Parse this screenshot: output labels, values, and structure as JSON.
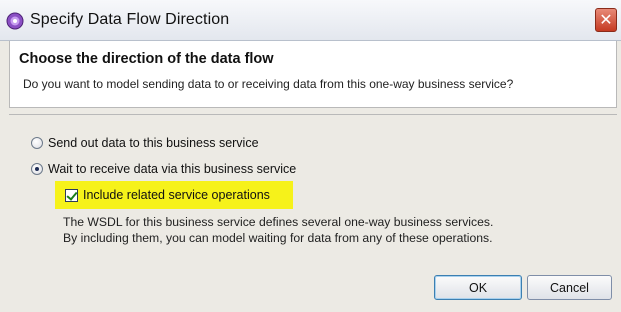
{
  "window": {
    "title": "Specify Data Flow Direction",
    "close_glyph": "✕",
    "icon": "wizard-icon"
  },
  "header": {
    "title": "Choose the direction of the data flow",
    "description": "Do you want to model sending data to or receiving data from this one-way business service?"
  },
  "options": {
    "send": {
      "label": "Send out data to this business service",
      "selected": false
    },
    "receive": {
      "label": "Wait to receive data via this business service",
      "selected": true
    },
    "include_related": {
      "label": "Include related service operations",
      "checked": true
    }
  },
  "note": {
    "line1": "The WSDL for this business service defines several one-way business services.",
    "line2": "By including them, you can model waiting for data from any of these operations."
  },
  "buttons": {
    "ok": "OK",
    "cancel": "Cancel"
  },
  "colors": {
    "highlight": "#f6f21a",
    "close": "#c53a22",
    "icon": "#7a3db0"
  }
}
